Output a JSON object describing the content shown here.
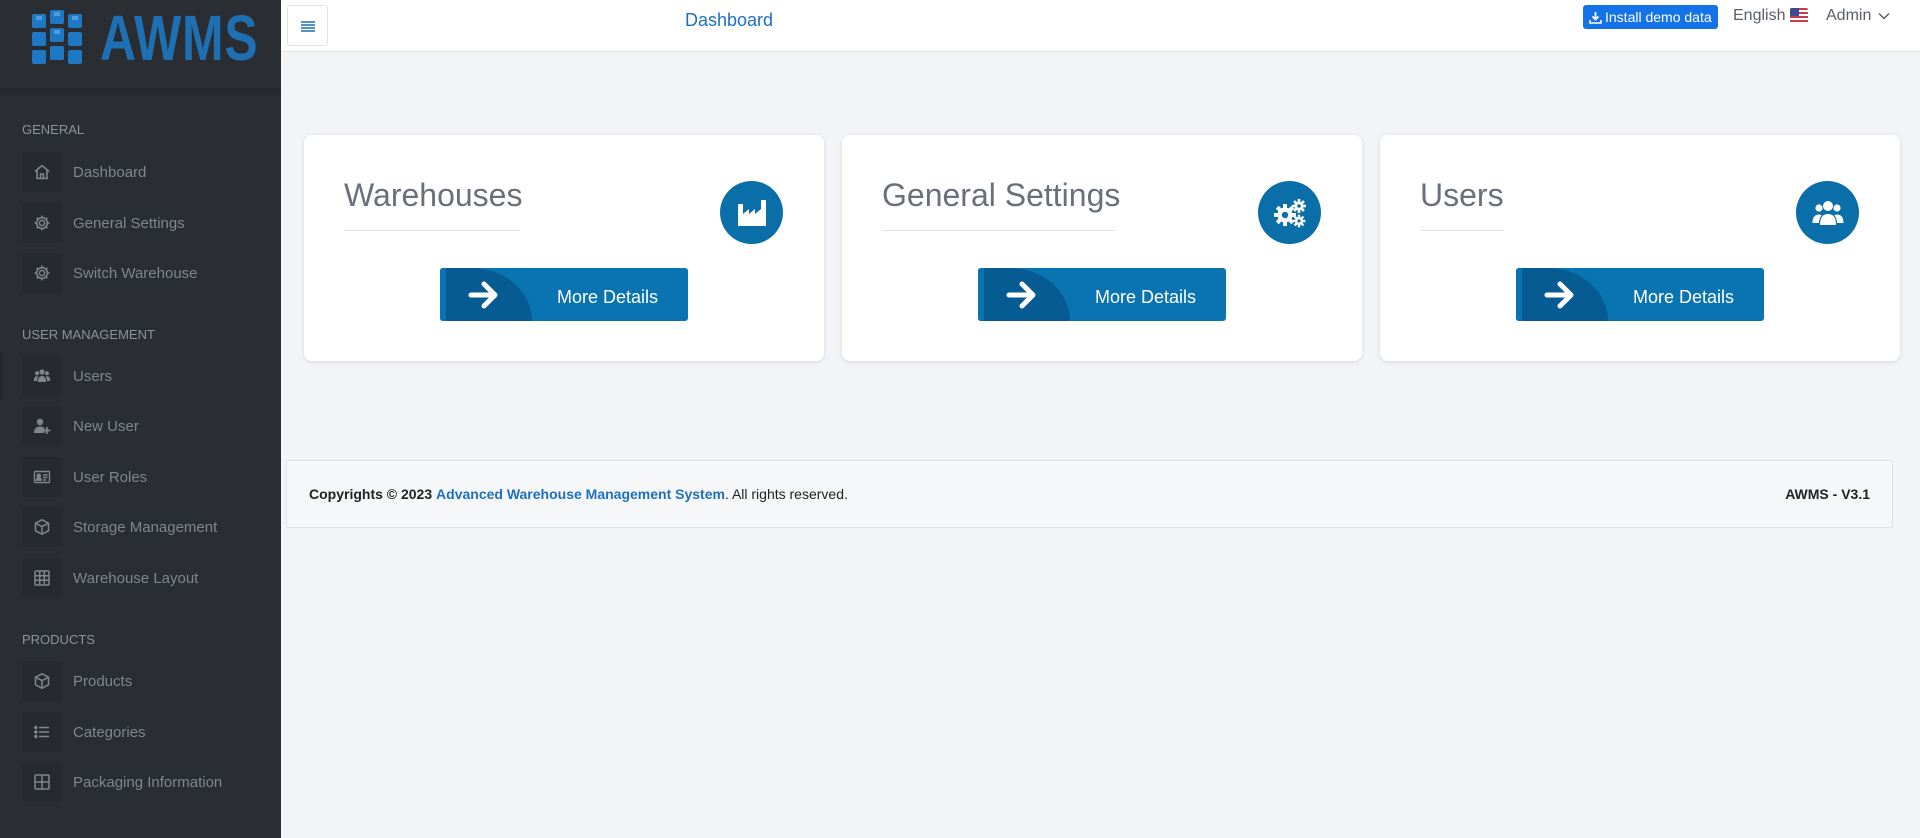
{
  "app": {
    "logo_text": "AWMS",
    "brand_color": "#1f6fb3"
  },
  "topbar": {
    "title": "Dashboard",
    "install_demo_label": "Install demo data",
    "language_label": "English",
    "user_label": "Admin"
  },
  "sidebar": {
    "sections": [
      {
        "title": "GENERAL",
        "items": [
          {
            "label": "Dashboard",
            "icon": "home-icon"
          },
          {
            "label": "General Settings",
            "icon": "gear-icon"
          },
          {
            "label": "Switch Warehouse",
            "icon": "gear-icon"
          }
        ]
      },
      {
        "title": "USER MANAGEMENT",
        "items": [
          {
            "label": "Users",
            "icon": "users-icon"
          },
          {
            "label": "New User",
            "icon": "user-plus-icon"
          },
          {
            "label": "User Roles",
            "icon": "id-card-icon"
          },
          {
            "label": "Storage Management",
            "icon": "box-icon"
          },
          {
            "label": "Warehouse Layout",
            "icon": "grid-icon"
          }
        ]
      },
      {
        "title": "PRODUCTS",
        "items": [
          {
            "label": "Products",
            "icon": "box-icon"
          },
          {
            "label": "Categories",
            "icon": "list-icon"
          },
          {
            "label": "Packaging Information",
            "icon": "grid-plus-icon"
          }
        ]
      }
    ]
  },
  "cards": [
    {
      "title": "Warehouses",
      "icon": "factory-icon",
      "button_label": "More Details"
    },
    {
      "title": "General Settings",
      "icon": "cogs-icon",
      "button_label": "More Details"
    },
    {
      "title": "Users",
      "icon": "users-icon",
      "button_label": "More Details"
    }
  ],
  "footer": {
    "copyright_prefix": "Copyrights © 2023",
    "link_text": "Advanced Warehouse Management System",
    "suffix": ". All rights reserved.",
    "version": "AWMS - V3.1"
  },
  "colors": {
    "sidebar_bg": "#2a2e33",
    "accent": "#0a6ea8",
    "link": "#1e6fc0",
    "install_button": "#1473e6"
  }
}
